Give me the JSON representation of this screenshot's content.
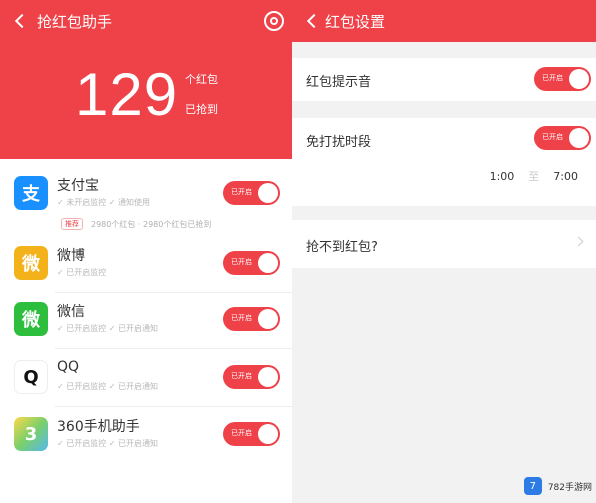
{
  "left": {
    "title": "抢红包助手",
    "count": "129",
    "count_unit": "个红包",
    "count_label": "已抢到",
    "notice_tag": "推荐",
    "notice_text": "2980个红包 · 2980个红包已抢到",
    "apps": [
      {
        "name": "支付宝",
        "meta": "✓ 未开启监控  ✓ 通知使用",
        "toggle": "已开启",
        "color": "#1890ff",
        "icon": "支"
      },
      {
        "name": "微博",
        "meta": "✓ 已开启监控",
        "toggle": "已开启",
        "color": "#f4b21a",
        "icon": "微"
      },
      {
        "name": "微信",
        "meta": "✓ 已开启监控  ✓ 已开启通知",
        "toggle": "已开启",
        "color": "#2dbe3e",
        "icon": "微"
      },
      {
        "name": "QQ",
        "meta": "✓ 已开启监控  ✓ 已开启通知",
        "toggle": "已开启",
        "color": "#ffffff",
        "icon": "Q"
      },
      {
        "name": "360手机助手",
        "meta": "✓ 已开启监控  ✓ 已开启通知",
        "toggle": "已开启",
        "color": "#ffd84a",
        "icon": "3"
      }
    ]
  },
  "right": {
    "title": "红包设置",
    "sound_label": "红包提示音",
    "sound_toggle": "已开启",
    "dnd_label": "免打扰时段",
    "dnd_toggle": "已开启",
    "dnd_start": "1:00",
    "dnd_sep": "至",
    "dnd_end": "7:00",
    "faq_label": "抢不到红包?"
  },
  "watermark": {
    "logo": "7",
    "text": "782手游网"
  }
}
